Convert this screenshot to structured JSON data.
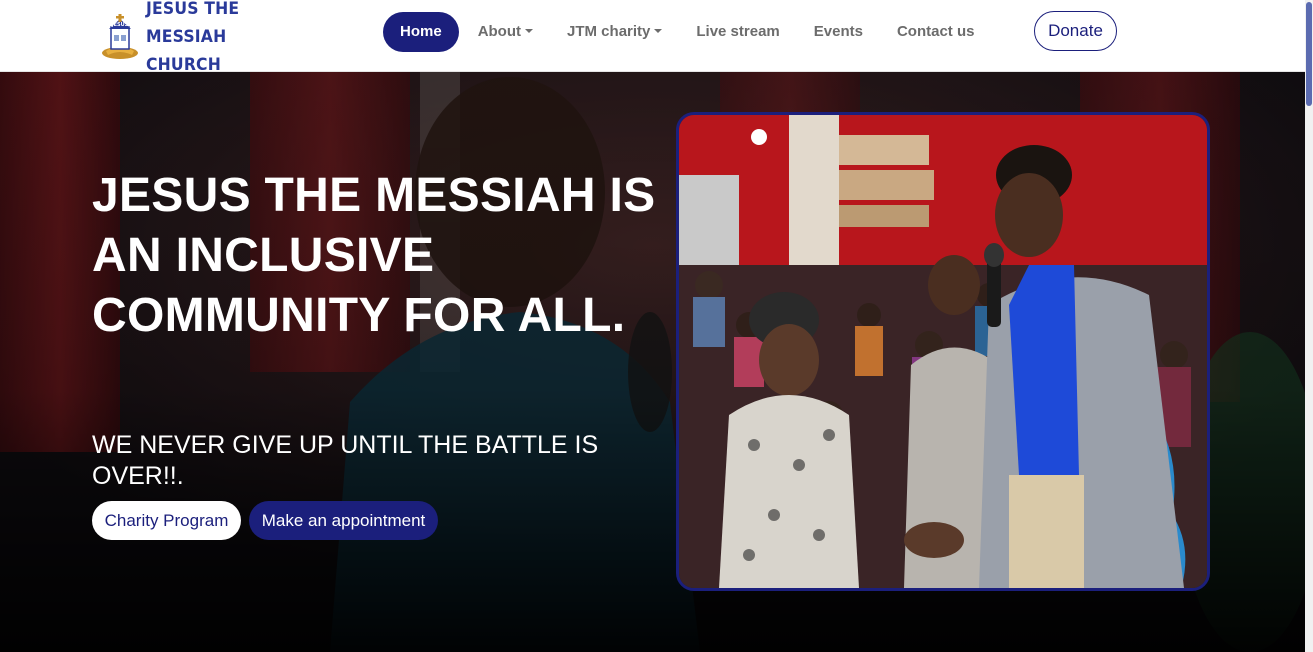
{
  "brand": {
    "name_line1": "JESUS THE MESSIAH",
    "name_line2": "CHURCH",
    "logo_text": "JESUS",
    "logo_icon": "church-logo-icon"
  },
  "nav": {
    "items": [
      {
        "label": "Home",
        "active": true,
        "dropdown": false
      },
      {
        "label": "About",
        "active": false,
        "dropdown": true
      },
      {
        "label": "JTM charity",
        "active": false,
        "dropdown": true
      },
      {
        "label": "Live stream",
        "active": false,
        "dropdown": false
      },
      {
        "label": "Events",
        "active": false,
        "dropdown": false
      },
      {
        "label": "Contact us",
        "active": false,
        "dropdown": false
      }
    ],
    "donate_label": "Donate"
  },
  "hero": {
    "title": "JESUS THE MESSIAH IS AN INCLUSIVE COMMUNITY FOR ALL.",
    "subtitle": "WE NEVER GIVE UP UNTIL THE BATTLE IS OVER!!.",
    "charity_button": "Charity Program",
    "appointment_button": "Make an appointment"
  },
  "colors": {
    "primary": "#1b1f7c",
    "brand_text": "#2a3a9a",
    "nav_text": "#6c6c6c",
    "white": "#ffffff"
  }
}
